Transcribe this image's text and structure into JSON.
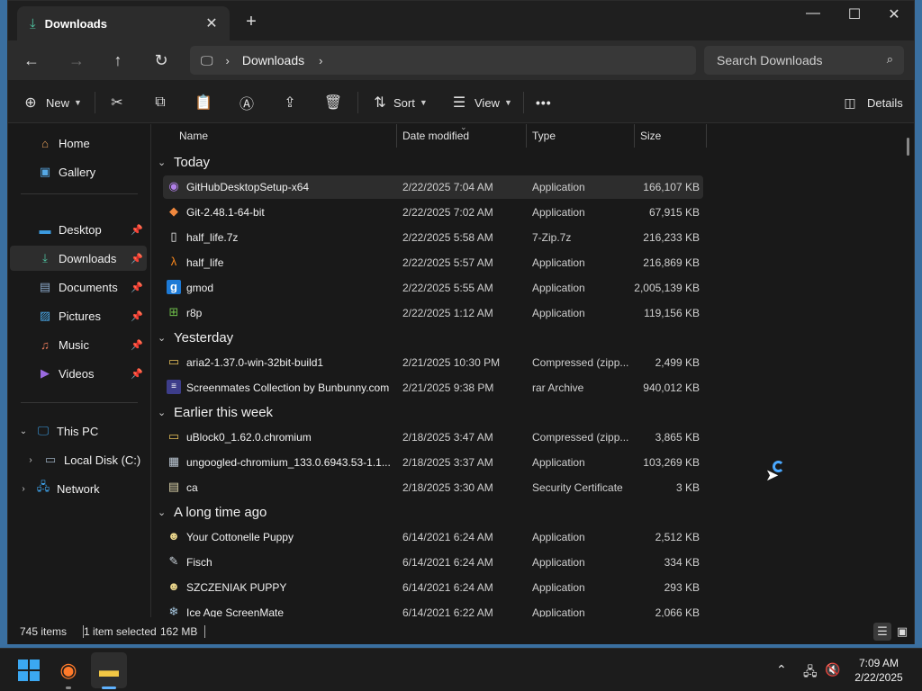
{
  "tab": {
    "title": "Downloads",
    "close_glyph": "✕",
    "new_tab_glyph": "+"
  },
  "window_controls": {
    "minimize": "—",
    "maximize": "☐",
    "close": "✕"
  },
  "address": {
    "breadcrumb": "Downloads"
  },
  "search": {
    "placeholder": "Search Downloads"
  },
  "commands": {
    "new": "New",
    "sort": "Sort",
    "view": "View",
    "more": "•••",
    "details": "Details"
  },
  "sidebar": {
    "top": [
      {
        "label": "Home",
        "icon": "home-icon"
      },
      {
        "label": "Gallery",
        "icon": "gallery-icon"
      }
    ],
    "pinned": [
      {
        "label": "Desktop",
        "icon": "desktop-icon"
      },
      {
        "label": "Downloads",
        "icon": "download-icon"
      },
      {
        "label": "Documents",
        "icon": "documents-icon"
      },
      {
        "label": "Pictures",
        "icon": "pictures-icon"
      },
      {
        "label": "Music",
        "icon": "music-icon"
      },
      {
        "label": "Videos",
        "icon": "videos-icon"
      }
    ],
    "tree": [
      {
        "label": "This PC",
        "icon": "pc-icon"
      },
      {
        "label": "Local Disk (C:)",
        "icon": "disk-icon"
      },
      {
        "label": "Network",
        "icon": "network-icon"
      }
    ]
  },
  "columns": {
    "name": "Name",
    "date": "Date modified",
    "type": "Type",
    "size": "Size"
  },
  "groups": {
    "today": "Today",
    "yesterday": "Yesterday",
    "earlier": "Earlier this week",
    "longago": "A long time ago"
  },
  "files": [
    {
      "name": "GitHubDesktopSetup-x64",
      "date": "2/22/2025 7:04 AM",
      "type": "Application",
      "size": "166,107 KB",
      "icon": "github-icon",
      "selected": true
    },
    {
      "name": "Git-2.48.1-64-bit",
      "date": "2/22/2025 7:02 AM",
      "type": "Application",
      "size": "67,915 KB",
      "icon": "git-icon"
    },
    {
      "name": "half_life.7z",
      "date": "2/22/2025 5:58 AM",
      "type": "7-Zip.7z",
      "size": "216,233 KB",
      "icon": "file-icon"
    },
    {
      "name": "half_life",
      "date": "2/22/2025 5:57 AM",
      "type": "Application",
      "size": "216,869 KB",
      "icon": "halflife-icon"
    },
    {
      "name": "gmod",
      "date": "2/22/2025 5:55 AM",
      "type": "Application",
      "size": "2,005,139 KB",
      "icon": "gmod-icon"
    },
    {
      "name": "r8p",
      "date": "2/22/2025 1:12 AM",
      "type": "Application",
      "size": "119,156 KB",
      "icon": "windows-app-icon"
    },
    {
      "name": "aria2-1.37.0-win-32bit-build1",
      "date": "2/21/2025 10:30 PM",
      "type": "Compressed (zipp...",
      "size": "2,499 KB",
      "icon": "zip-folder-icon"
    },
    {
      "name": "Screenmates Collection by Bunbunny.com",
      "date": "2/21/2025 9:38 PM",
      "type": "rar Archive",
      "size": "940,012 KB",
      "icon": "rar-icon"
    },
    {
      "name": "uBlock0_1.62.0.chromium",
      "date": "2/18/2025 3:47 AM",
      "type": "Compressed (zipp...",
      "size": "3,865 KB",
      "icon": "zip-folder-icon"
    },
    {
      "name": "ungoogled-chromium_133.0.6943.53-1.1...",
      "date": "2/18/2025 3:37 AM",
      "type": "Application",
      "size": "103,269 KB",
      "icon": "installer-icon"
    },
    {
      "name": "ca",
      "date": "2/18/2025 3:30 AM",
      "type": "Security Certificate",
      "size": "3 KB",
      "icon": "certificate-icon"
    },
    {
      "name": "Your Cottonelle Puppy",
      "date": "6/14/2021 6:24 AM",
      "type": "Application",
      "size": "2,512 KB",
      "icon": "puppy-icon"
    },
    {
      "name": "Fisch",
      "date": "6/14/2021 6:24 AM",
      "type": "Application",
      "size": "334 KB",
      "icon": "fish-icon"
    },
    {
      "name": "SZCZENIAK PUPPY",
      "date": "6/14/2021 6:24 AM",
      "type": "Application",
      "size": "293 KB",
      "icon": "puppy-icon"
    },
    {
      "name": "Ice Age ScreenMate",
      "date": "6/14/2021 6:22 AM",
      "type": "Application",
      "size": "2,066 KB",
      "icon": "iceage-icon"
    }
  ],
  "status": {
    "items": "745 items",
    "selected": "1 item selected",
    "size": "162 MB"
  },
  "taskbar": {
    "time": "7:09 AM",
    "date": "2/22/2025"
  }
}
